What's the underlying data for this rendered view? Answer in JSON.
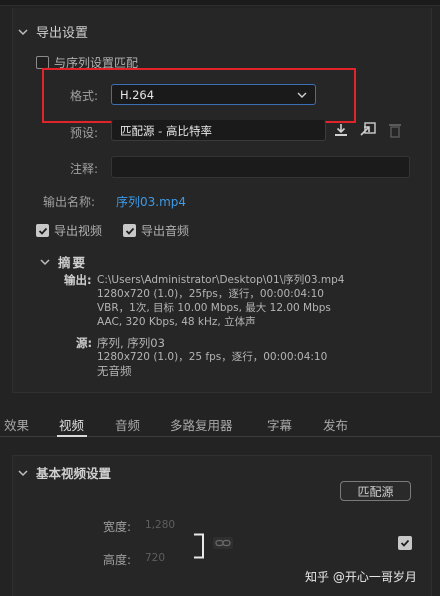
{
  "export": {
    "section_title": "导出设置",
    "match_sequence_label": "与序列设置匹配",
    "format_label": "格式:",
    "format_value": "H.264",
    "preset_label": "预设:",
    "preset_value": "匹配源 - 高比特率",
    "comments_label": "注释:",
    "comments_value": "",
    "output_name_label": "输出名称:",
    "output_name_value": "序列03.mp4",
    "export_video_label": "导出视频",
    "export_audio_label": "导出音频",
    "export_video_checked": true,
    "export_audio_checked": true,
    "match_sequence_checked": false
  },
  "summary": {
    "title": "摘要",
    "output_key": "输出:",
    "output_lines": [
      "C:\\Users\\Administrator\\Desktop\\01\\序列03.mp4",
      "1280x720 (1.0)，25fps，逐行，00:00:04:10",
      "VBR，1次, 目标 10.00 Mbps, 最大 12.00 Mbps",
      "AAC, 320 Kbps, 48  kHz, 立体声"
    ],
    "source_key": "源:",
    "source_lines": [
      "序列, 序列03",
      "1280x720 (1.0)，25 fps，逐行，00:00:04:10",
      "无音频"
    ]
  },
  "tabs": [
    "效果",
    "视频",
    "音频",
    "多路复用器",
    "字幕",
    "发布"
  ],
  "active_tab": "视频",
  "basic_video": {
    "title": "基本视频设置",
    "match_source_button": "匹配源",
    "width_label": "宽度:",
    "width_value": "1,280",
    "height_label": "高度:",
    "height_value": "720",
    "checkbox_checked": true
  },
  "watermark": "知乎 @开心一哥岁月",
  "colors": {
    "highlight_box": "#e0242a",
    "link": "#3d9ae8",
    "dropdown_focus": "#3d6fb7"
  }
}
